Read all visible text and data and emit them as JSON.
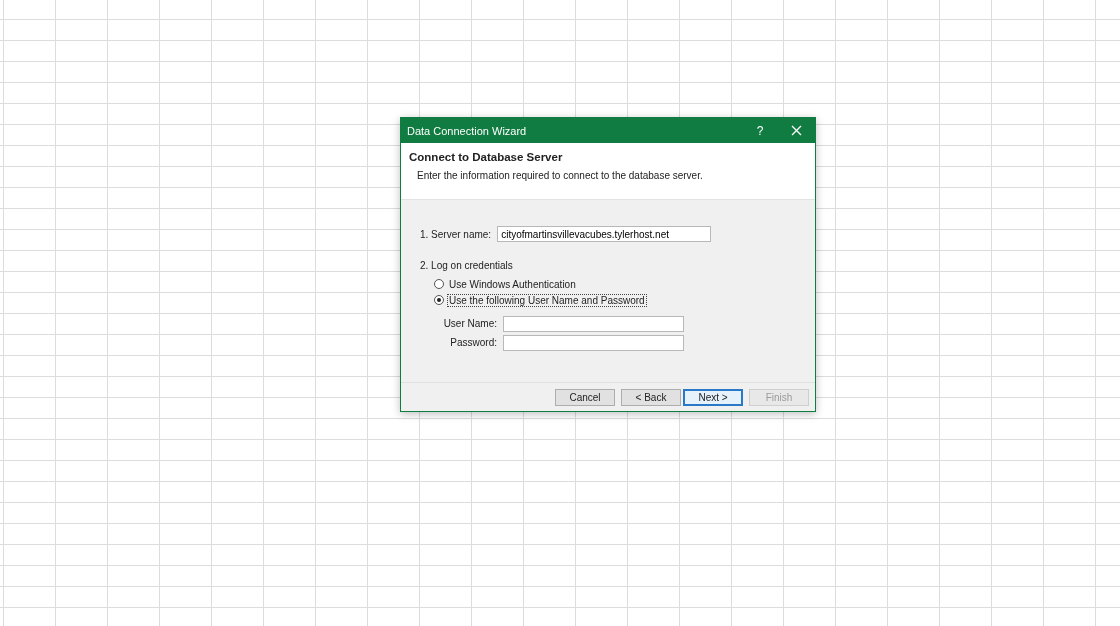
{
  "window": {
    "title": "Data Connection Wizard",
    "help": "?"
  },
  "header": {
    "title": "Connect to Database Server",
    "subtitle": "Enter the information required to connect to the database server."
  },
  "server": {
    "label": "1. Server name:",
    "value": "cityofmartinsvillevacubes.tylerhost.net"
  },
  "credentials": {
    "label": "2. Log on credentials",
    "options": [
      {
        "label": "Use Windows Authentication",
        "selected": false
      },
      {
        "label": "Use the following User Name and Password",
        "selected": true
      }
    ],
    "fields": [
      {
        "label": "User Name:"
      },
      {
        "label": "Password:"
      }
    ]
  },
  "buttons": [
    {
      "label": "Cancel",
      "default": false,
      "disabled": false
    },
    {
      "label": "< Back",
      "default": false,
      "disabled": false
    },
    {
      "label": "Next >",
      "default": true,
      "disabled": false
    },
    {
      "label": "Finish",
      "default": false,
      "disabled": true
    }
  ]
}
